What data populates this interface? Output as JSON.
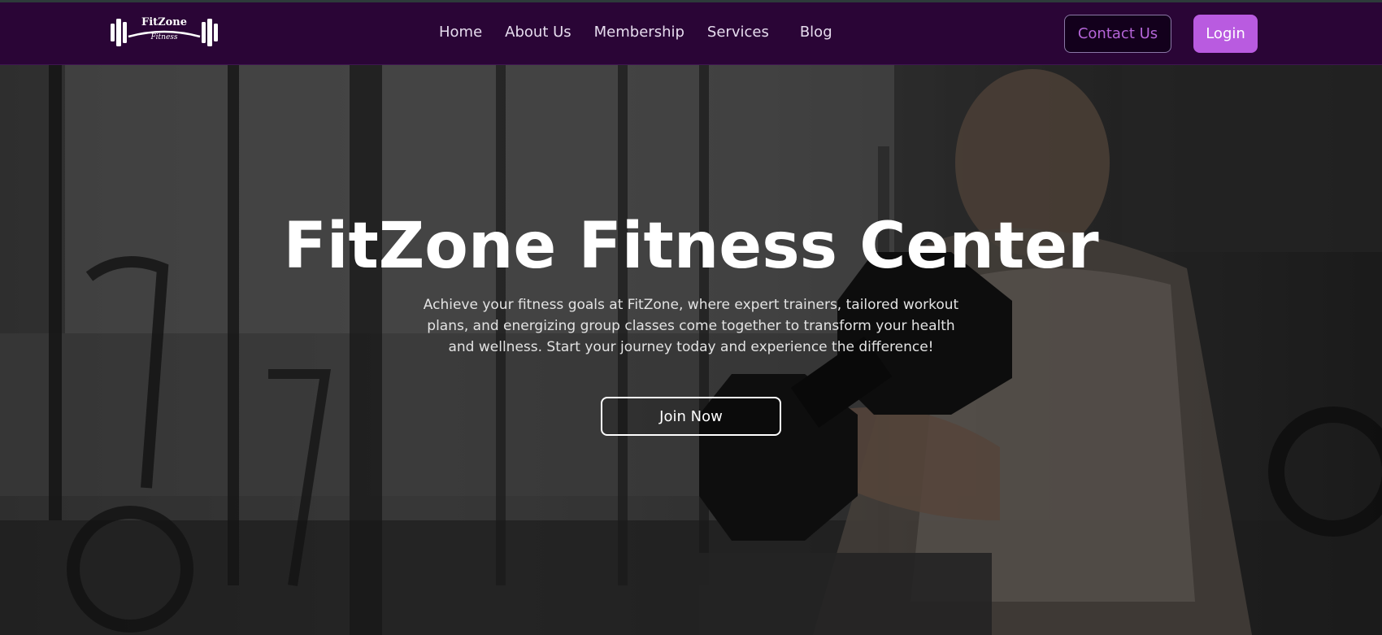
{
  "brand": {
    "logo_name": "FitZone",
    "logo_tagline": "Fitness"
  },
  "nav": {
    "links": [
      "Home",
      "About Us",
      "Membership",
      "Services",
      "Blog"
    ],
    "contact_label": "Contact Us",
    "login_label": "Login"
  },
  "hero": {
    "title": "FitZone Fitness Center",
    "description": "Achieve your fitness goals at FitZone, where expert trainers, tailored workout plans, and energizing group classes come together to transform your health and wellness. Start your journey today and experience the difference!",
    "cta_label": "Join Now"
  },
  "colors": {
    "navbar": "#2a0536",
    "accent": "#b95be0",
    "contact_text": "#b565d8"
  }
}
